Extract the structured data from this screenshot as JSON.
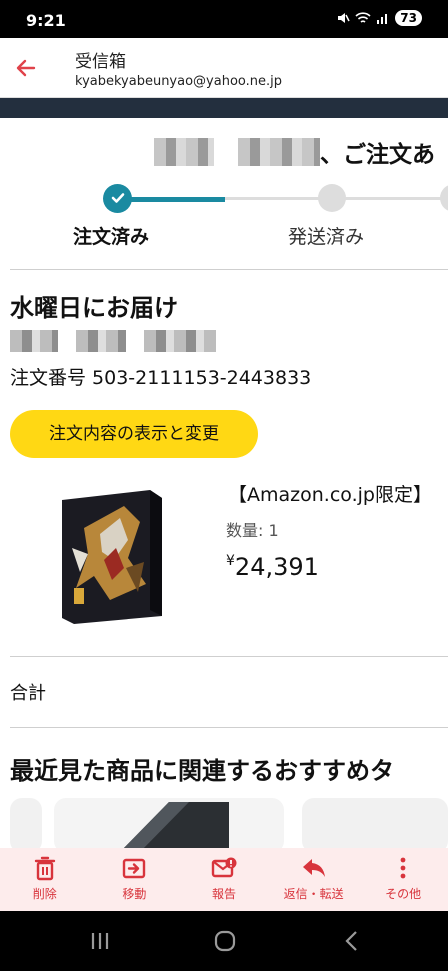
{
  "status_bar": {
    "time": "9:21",
    "battery": "73",
    "icons": [
      "mute-icon",
      "wifi-icon",
      "signal-icon"
    ]
  },
  "header": {
    "title": "受信箱",
    "email": "kyabekyabeunyao@yahoo.ne.jp"
  },
  "email": {
    "greeting_suffix": "、ご注文あ",
    "steps": [
      "注文済み",
      "発送済み"
    ],
    "delivery": "水曜日にお届け",
    "order_number": "注文番号 503-2111153-2443833",
    "button_label": "注文内容の表示と変更",
    "product": {
      "title": "【Amazon.co.jp限定】",
      "quantity": "数量: 1",
      "currency": "¥",
      "price": "24,391"
    },
    "total_label": "合計",
    "recommend_title": "最近見た商品に関連するおすすめタ"
  },
  "toolbar": [
    {
      "label": "削除",
      "icon": "trash-icon"
    },
    {
      "label": "移動",
      "icon": "move-icon"
    },
    {
      "label": "報告",
      "icon": "report-icon"
    },
    {
      "label": "返信・転送",
      "icon": "reply-icon"
    },
    {
      "label": "その他",
      "icon": "more-icon"
    }
  ],
  "colors": {
    "accent_red": "#d8343c",
    "progress_teal": "#1a8aa1",
    "button_yellow": "#ffd814",
    "toolbar_bg": "#fdecec"
  }
}
